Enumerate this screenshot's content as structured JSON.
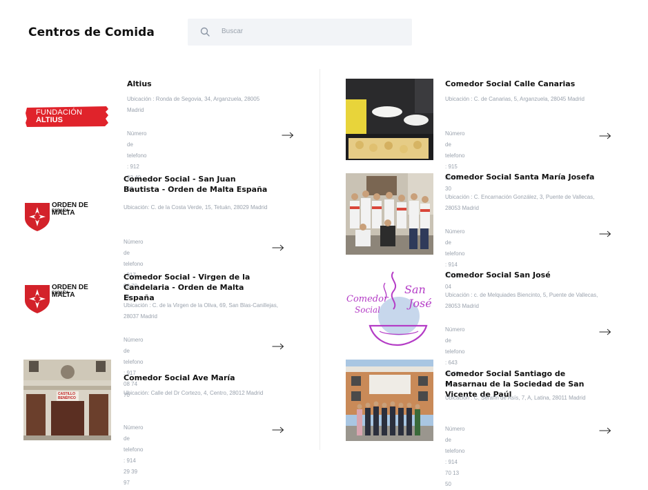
{
  "header": {
    "title": "Centros de Comida",
    "search_placeholder": "Buscar",
    "search_icon": "search-icon"
  },
  "cards": [
    {
      "title": "Altius",
      "location": "Ubicación : Ronda de Segovia, 34, Arganzuela, 28005 Madrid",
      "phone": "Número de telefono : 912 22 40 50",
      "logo_line1": "FUNDACIÓN",
      "logo_line2": "ALTIUS"
    },
    {
      "title": "Comedor Social - San Juan Bautista - Orden de Malta España",
      "location": "Ubicación: C. de la Costa Verde, 15, Tetuán, 28029 Madrid",
      "phone": "Número de telefono : 917 08 70 74",
      "logo_line1": "ORDEN DE MALTA",
      "logo_line2": "ESPAÑA"
    },
    {
      "title": "Comedor Social - Virgen de la Candelaria - Orden de Malta España",
      "location": "Ubicación : C. de la Virgen de la Oliva, 69, San Blas-Canillejas, 28037 Madrid",
      "phone": "Número de telefono : 917 08 74 70",
      "logo_line1": "ORDEN DE MALTA",
      "logo_line2": "ESPAÑA"
    },
    {
      "title": "Comedor Social Ave María",
      "location": "Ubicación: Calle del Dr Cortezo, 4, Centro, 28012 Madrid",
      "phone": "Número de telefono : 914 29 39 97",
      "sign_line1": "CASTILLO",
      "sign_line2": "BENÉFICO"
    },
    {
      "title": "Comedor Social Calle Canarias",
      "location": "Ubicación : C. de Canarias, 5, Arganzuela, 28045 Madrid",
      "phone": "Número de telefono : 915 35 93 30"
    },
    {
      "title": "Comedor Social Santa María Josefa",
      "location": "Ubicación : C. Encarnación González, 3, Puente de Vallecas, 28053 Madrid",
      "phone": "Número de telefono : 914 77 10 04"
    },
    {
      "title": "Comedor Social San José",
      "location": "Ubicación : c. de Melquiades Biencinto, 5, Puente de Vallecas, 28053 Madrid",
      "phone": "Número de telefono : 643 69 60 95",
      "logo_line1": "Comedor",
      "logo_line2": "Social",
      "logo_line3": "San",
      "logo_line4": "José"
    },
    {
      "title": "Comedor Social Santiago de Masarnau de la Sociedad de San Vicente de Paúl",
      "location": "Ubicación : C. Serafín de Asís, 7, A, Latina, 28011 Madrid",
      "phone": "Número de telefono : 914 70 13 50"
    }
  ],
  "colors": {
    "altius_red": "#e0232b",
    "malta_red": "#d3222a",
    "san_jose_purple": "#b43cc6",
    "search_bg": "#f2f4f7",
    "muted_text": "#9aa2ad"
  }
}
